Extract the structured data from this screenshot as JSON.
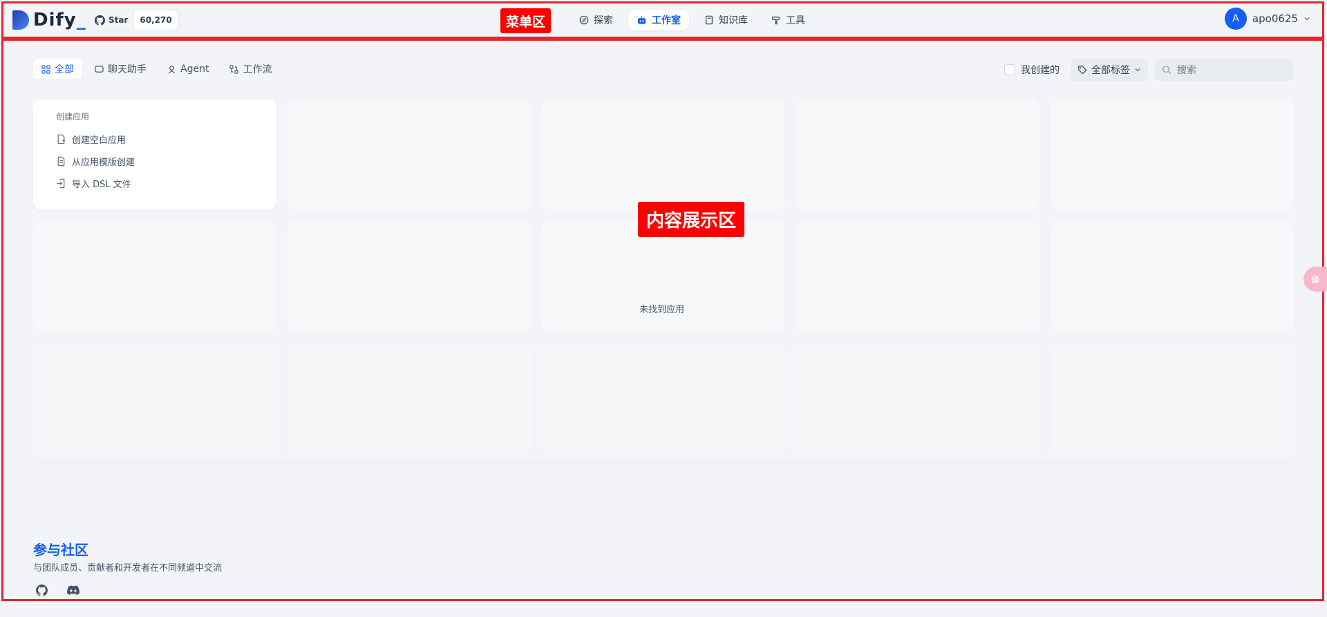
{
  "brand": {
    "name": "Dify",
    "suffix": "_"
  },
  "github": {
    "star_label": "Star",
    "count": "60,270"
  },
  "annotations": {
    "menu_area": "菜单区",
    "content_area": "内容展示区"
  },
  "nav": {
    "items": [
      {
        "label": "探索",
        "icon": "compass-icon"
      },
      {
        "label": "工作室",
        "icon": "robot-icon",
        "active": true
      },
      {
        "label": "知识库",
        "icon": "book-icon"
      },
      {
        "label": "工具",
        "icon": "hammer-icon"
      }
    ]
  },
  "user": {
    "avatar_letter": "A",
    "name": "apo0625"
  },
  "tabs": [
    {
      "label": "全部",
      "icon": "grid-icon",
      "active": true
    },
    {
      "label": "聊天助手",
      "icon": "chat-icon"
    },
    {
      "label": "Agent",
      "icon": "agent-icon"
    },
    {
      "label": "工作流",
      "icon": "workflow-icon"
    }
  ],
  "filters": {
    "mine_label": "我创建的",
    "tags_label": "全部标签",
    "search_placeholder": "搜索"
  },
  "create_card": {
    "title": "创建应用",
    "items": [
      {
        "label": "创建空白应用",
        "icon": "file-plus-icon"
      },
      {
        "label": "从应用模版创建",
        "icon": "template-icon"
      },
      {
        "label": "导入 DSL 文件",
        "icon": "import-icon"
      }
    ]
  },
  "empty_state": "未找到应用",
  "community": {
    "title": "参与社区",
    "description": "与团队成员、贡献者和开发者在不同频道中交流"
  },
  "floating_button": "译",
  "colors": {
    "accent": "#155eef",
    "frame": "#e3252b",
    "background": "#f2f4f7"
  }
}
